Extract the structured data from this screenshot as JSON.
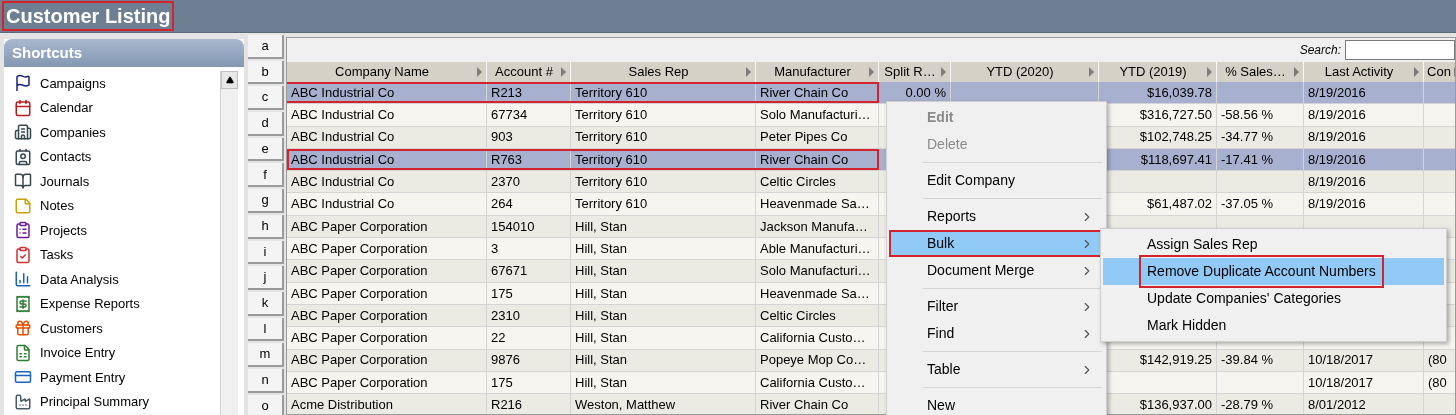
{
  "title": {
    "text": "Customer Listing",
    "outlined": true
  },
  "shortcuts": {
    "title": "Shortcuts",
    "items": [
      "Campaigns",
      "Calendar",
      "Companies",
      "Contacts",
      "Journals",
      "Notes",
      "Projects",
      "Tasks",
      "Data Analysis",
      "Expense Reports",
      "Customers",
      "Invoice Entry",
      "Payment Entry",
      "Principal Summary"
    ]
  },
  "letters": [
    "a",
    "b",
    "c",
    "d",
    "e",
    "f",
    "g",
    "h",
    "i",
    "j",
    "k",
    "l",
    "m",
    "n",
    "o"
  ],
  "search": {
    "label": "Search:"
  },
  "table": {
    "columns": [
      "Company Name",
      "Account #",
      "Sales Rep",
      "Manufacturer",
      "Split R…",
      "YTD (2020)",
      "YTD (2019)",
      "% Sales…",
      "Last Activity",
      "Con"
    ],
    "rows": [
      {
        "selected": true,
        "outlined": true,
        "cells": [
          "ABC Industrial Co",
          "R213",
          "Territory 610",
          "River Chain Co",
          "0.00 %",
          null,
          "$16,039.78",
          null,
          "8/19/2016",
          null
        ]
      },
      {
        "selected": false,
        "outlined": false,
        "cells": [
          "ABC Industrial Co",
          "67734",
          "Territory 610",
          "Solo Manufacturi…",
          null,
          null,
          "$316,727.50",
          "-58.56 %",
          "8/19/2016",
          null
        ]
      },
      {
        "selected": false,
        "outlined": false,
        "cells": [
          "ABC Industrial Co",
          "903",
          "Territory 610",
          "Peter Pipes Co",
          null,
          null,
          "$102,748.25",
          "-34.77 %",
          "8/19/2016",
          null
        ]
      },
      {
        "selected": true,
        "outlined": true,
        "cells": [
          "ABC Industrial Co",
          "R763",
          "Territory 610",
          "River Chain Co",
          null,
          null,
          "$118,697.41",
          "-17.41 %",
          "8/19/2016",
          null
        ]
      },
      {
        "selected": false,
        "outlined": false,
        "cells": [
          "ABC Industrial Co",
          "2370",
          "Territory 610",
          "Celtic Circles",
          null,
          null,
          null,
          null,
          "8/19/2016",
          null
        ]
      },
      {
        "selected": false,
        "outlined": false,
        "cells": [
          "ABC Industrial Co",
          "264",
          "Territory 610",
          "Heavenmade Sa…",
          null,
          null,
          "$61,487.02",
          "-37.05 %",
          "8/19/2016",
          null
        ]
      },
      {
        "selected": false,
        "outlined": false,
        "cells": [
          "ABC Paper Corporation",
          "154010",
          "Hill, Stan",
          "Jackson Manufa…",
          null,
          null,
          null,
          null,
          null,
          null
        ]
      },
      {
        "selected": false,
        "outlined": false,
        "cells": [
          "ABC Paper Corporation",
          "3",
          "Hill, Stan",
          "Able Manufacturi…",
          null,
          null,
          null,
          null,
          null,
          null
        ]
      },
      {
        "selected": false,
        "outlined": false,
        "cells": [
          "ABC Paper Corporation",
          "67671",
          "Hill, Stan",
          "Solo Manufacturi…",
          null,
          null,
          null,
          null,
          null,
          null
        ]
      },
      {
        "selected": false,
        "outlined": false,
        "cells": [
          "ABC Paper Corporation",
          "175",
          "Hill, Stan",
          "Heavenmade Sa…",
          null,
          null,
          null,
          null,
          null,
          null
        ]
      },
      {
        "selected": false,
        "outlined": false,
        "cells": [
          "ABC Paper Corporation",
          "2310",
          "Hill, Stan",
          "Celtic Circles",
          null,
          null,
          null,
          null,
          null,
          null
        ]
      },
      {
        "selected": false,
        "outlined": false,
        "cells": [
          "ABC Paper Corporation",
          "22",
          "Hill, Stan",
          "California Custo…",
          null,
          null,
          null,
          null,
          null,
          null
        ]
      },
      {
        "selected": false,
        "outlined": false,
        "cells": [
          "ABC Paper Corporation",
          "9876",
          "Hill, Stan",
          "Popeye Mop Co…",
          null,
          null,
          "$142,919.25",
          "-39.84 %",
          "10/18/2017",
          "(80"
        ]
      },
      {
        "selected": false,
        "outlined": false,
        "cells": [
          "ABC Paper Corporation",
          "175",
          "Hill, Stan",
          "California Custo…",
          null,
          null,
          null,
          null,
          "10/18/2017",
          "(80"
        ]
      },
      {
        "selected": false,
        "outlined": false,
        "cells": [
          "Acme Distribution",
          "R216",
          "Weston, Matthew",
          "River Chain Co",
          null,
          null,
          "$136,937.00",
          "-28.79 %",
          "8/01/2012",
          null
        ]
      }
    ]
  },
  "context_menu": {
    "items": [
      {
        "kind": "item",
        "label": "Edit",
        "disabled": true,
        "bold": true,
        "submenu": false,
        "selected": false,
        "outlined": false
      },
      {
        "kind": "item",
        "label": "Delete",
        "disabled": true,
        "bold": false,
        "submenu": false,
        "selected": false,
        "outlined": false
      },
      {
        "kind": "separator"
      },
      {
        "kind": "item",
        "label": "Edit Company",
        "disabled": false,
        "bold": false,
        "submenu": false,
        "selected": false,
        "outlined": false
      },
      {
        "kind": "separator"
      },
      {
        "kind": "item",
        "label": "Reports",
        "disabled": false,
        "bold": false,
        "submenu": true,
        "selected": false,
        "outlined": false
      },
      {
        "kind": "item",
        "label": "Bulk",
        "disabled": false,
        "bold": false,
        "submenu": true,
        "selected": true,
        "outlined": true
      },
      {
        "kind": "item",
        "label": "Document Merge",
        "disabled": false,
        "bold": false,
        "submenu": true,
        "selected": false,
        "outlined": false
      },
      {
        "kind": "separator"
      },
      {
        "kind": "item",
        "label": "Filter",
        "disabled": false,
        "bold": false,
        "submenu": true,
        "selected": false,
        "outlined": false
      },
      {
        "kind": "item",
        "label": "Find",
        "disabled": false,
        "bold": false,
        "submenu": true,
        "selected": false,
        "outlined": false
      },
      {
        "kind": "separator"
      },
      {
        "kind": "item",
        "label": "Table",
        "disabled": false,
        "bold": false,
        "submenu": true,
        "selected": false,
        "outlined": false
      },
      {
        "kind": "separator"
      },
      {
        "kind": "item",
        "label": "New",
        "disabled": false,
        "bold": false,
        "submenu": false,
        "selected": false,
        "outlined": false
      }
    ]
  },
  "submenu": {
    "items": [
      {
        "label": "Assign Sales Rep",
        "selected": false,
        "outlined": false
      },
      {
        "label": "Remove Duplicate Account Numbers",
        "selected": true,
        "outlined": true
      },
      {
        "label": "Update Companies' Categories",
        "selected": false,
        "outlined": false
      },
      {
        "label": "Mark Hidden",
        "selected": false,
        "outlined": false
      }
    ]
  }
}
